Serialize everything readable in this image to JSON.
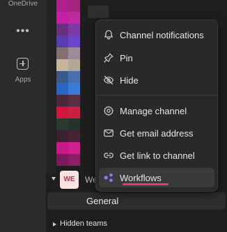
{
  "rail": {
    "onedrive_label": "OneDrive",
    "more_label": "•••",
    "apps_label": "Apps"
  },
  "team": {
    "avatar_initials": "WE",
    "name_partial": "We"
  },
  "channel": {
    "label": "General"
  },
  "hidden_teams": {
    "label": "Hidden teams"
  },
  "menu": {
    "items": [
      {
        "label": "Channel notifications",
        "icon": "bell-icon"
      },
      {
        "label": "Pin",
        "icon": "pin-icon"
      },
      {
        "label": "Hide",
        "icon": "eye-off-icon"
      },
      {
        "label": "Manage channel",
        "icon": "gear-icon"
      },
      {
        "label": "Get email address",
        "icon": "envelope-icon"
      },
      {
        "label": "Get link to channel",
        "icon": "link-icon"
      },
      {
        "label": "Workflows",
        "icon": "workflows-icon"
      }
    ]
  },
  "colors": {
    "accent_underline": "#e23d6a",
    "workflows_icon": "#8b7cf0",
    "avatar_bg": "#fde2e2",
    "avatar_text": "#c4314b"
  }
}
